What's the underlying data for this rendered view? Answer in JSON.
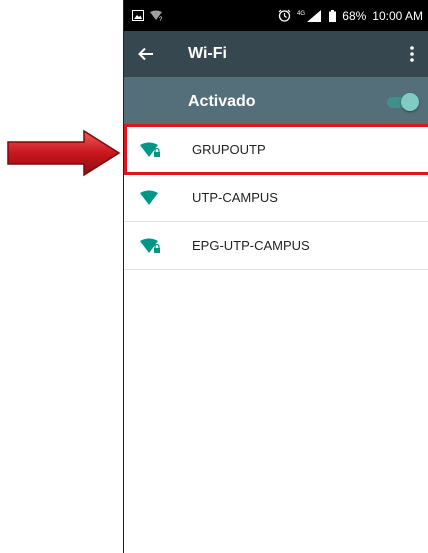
{
  "status_bar": {
    "signal_label": "4G",
    "battery": "68%",
    "time": "10:00 AM"
  },
  "app_bar": {
    "title": "Wi-Fi",
    "back_icon": "arrow-back-icon",
    "menu_icon": "more-vert-icon"
  },
  "switch": {
    "label": "Activado",
    "state": "on"
  },
  "networks": [
    {
      "ssid": "GRUPOUTP",
      "secured": true,
      "highlighted": true
    },
    {
      "ssid": "UTP-CAMPUS",
      "secured": false,
      "highlighted": false
    },
    {
      "ssid": "EPG-UTP-CAMPUS",
      "secured": true,
      "highlighted": false
    }
  ],
  "colors": {
    "app_bar": "#37474f",
    "switch_bar": "#546e7a",
    "accent": "#2bb5a0",
    "highlight": "#e0141c"
  }
}
